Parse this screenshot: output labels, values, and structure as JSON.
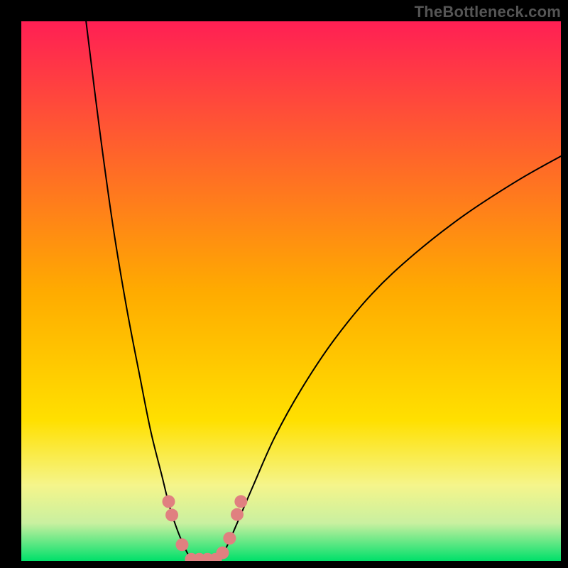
{
  "watermark": "TheBottleneck.com",
  "chart_data": {
    "type": "line",
    "title": "",
    "xlabel": "",
    "ylabel": "",
    "xlim": [
      0,
      100
    ],
    "ylim": [
      0,
      100
    ],
    "grid": false,
    "legend": false,
    "background_gradient_top": "#ff1f54",
    "background_gradient_mid": "#ffd400",
    "background_gradient_bottom": "#00e06a",
    "series": [
      {
        "name": "left-curve",
        "x": [
          12.0,
          14.5,
          17.0,
          19.5,
          22.0,
          24.0,
          26.0,
          27.5,
          29.0,
          30.5,
          31.5
        ],
        "y": [
          100.0,
          80.0,
          62.0,
          47.0,
          34.0,
          24.0,
          16.0,
          10.0,
          5.5,
          2.0,
          0.2
        ]
      },
      {
        "name": "right-curve",
        "x": [
          36.5,
          38.0,
          40.0,
          43.0,
          47.0,
          52.0,
          58.0,
          65.0,
          73.0,
          82.0,
          92.0,
          100.0
        ],
        "y": [
          0.2,
          2.5,
          7.0,
          14.0,
          23.0,
          32.0,
          41.0,
          49.5,
          57.0,
          64.0,
          70.5,
          75.0
        ]
      },
      {
        "name": "floor-segment",
        "x": [
          31.5,
          36.5
        ],
        "y": [
          0.2,
          0.2
        ]
      }
    ],
    "markers": [
      {
        "name": "left-dot-1",
        "x": 27.3,
        "y": 11.0
      },
      {
        "name": "left-dot-2",
        "x": 27.9,
        "y": 8.5
      },
      {
        "name": "left-dot-3",
        "x": 29.8,
        "y": 3.0
      },
      {
        "name": "floor-dot-1",
        "x": 31.5,
        "y": 0.3
      },
      {
        "name": "floor-dot-2",
        "x": 33.0,
        "y": 0.3
      },
      {
        "name": "floor-dot-3",
        "x": 34.5,
        "y": 0.3
      },
      {
        "name": "floor-dot-4",
        "x": 36.0,
        "y": 0.3
      },
      {
        "name": "right-dot-1",
        "x": 37.3,
        "y": 1.5
      },
      {
        "name": "right-dot-2",
        "x": 38.6,
        "y": 4.2
      },
      {
        "name": "right-dot-3",
        "x": 40.0,
        "y": 8.6
      },
      {
        "name": "right-dot-4",
        "x": 40.7,
        "y": 11.0
      }
    ],
    "marker_color": "#e08080",
    "marker_radius_px": 9,
    "curve_color": "#000000",
    "curve_stroke_px": 2
  }
}
